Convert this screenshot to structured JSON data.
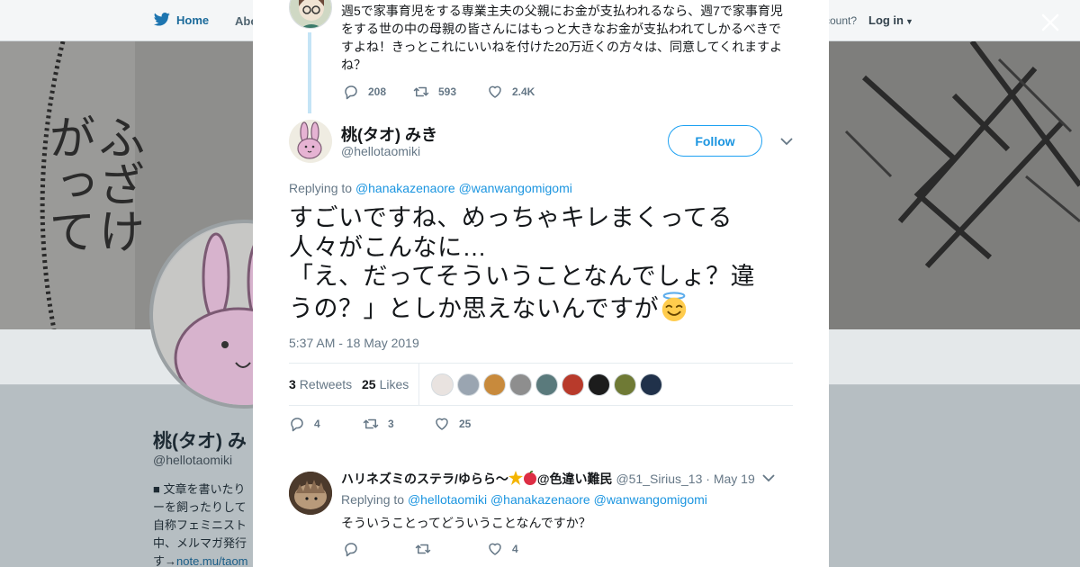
{
  "background": {
    "nav": {
      "home_label": "Home",
      "about_label": "Abo",
      "account_prompt": "ccount?",
      "login_label": "Log in"
    },
    "banner_text": [
      "ふざけ",
      "がって"
    ],
    "profile": {
      "name": "桃(タオ) み",
      "handle": "@hellotaomiki",
      "bio_lines": [
        "■ 文章を書いたり",
        "ーを飼ったりして",
        "自称フェミニスト",
        "中、メルマガ発行"
      ],
      "bio_link_prefix": "す→",
      "bio_link": "note.mu/taom"
    }
  },
  "parent_tweet": {
    "text": "週5で家事育児をする専業主夫の父親にお金が支払われるなら、週7で家事育児をする世の中の母親の皆さんにはもっと大きなお金が支払われてしかるべきですよね！きっとこれにいいねを付けた20万近くの方々は、同意してくれますよね？",
    "replies": "208",
    "retweets": "593",
    "likes": "2.4K"
  },
  "tweet": {
    "author_name": "桃(タオ) みき",
    "author_handle": "@hellotaomiki",
    "follow_label": "Follow",
    "replying_prefix": "Replying to",
    "replying_to": [
      "@hanakazenaore",
      "@wanwangomigomi"
    ],
    "text_line1": "すごいですね、めっちゃキレまくってる",
    "text_line2": "人々がこんなに…",
    "text_line3": "「え、だってそういうことなんでしょ？違",
    "text_line4": "うの？」としか思えないんですが",
    "timestamp": "5:37 AM - 18 May 2019",
    "retweet_count": "3",
    "retweet_label": "Retweets",
    "like_count": "25",
    "like_label": "Likes",
    "action_replies": "4",
    "action_retweets": "3",
    "action_likes": "25",
    "liker_colors": [
      "#e9e3e0",
      "#9aa5b1",
      "#c88a3c",
      "#8e8e8e",
      "#5a7a7c",
      "#b83a2b",
      "#1c1c1c",
      "#6f7a35",
      "#20314a"
    ]
  },
  "reply_tweet": {
    "name_part1": "ハリネズミのステラ/ゆらら〜",
    "name_part2": "@色違い難民",
    "handle": "@51_Sirius_13",
    "separator": "·",
    "date": "May 19",
    "replying_prefix": "Replying to",
    "replying_to": [
      "@hellotaomiki",
      "@hanakazenaore",
      "@wanwangomigomi"
    ],
    "text": "そういうことってどういうことなんですか？",
    "likes": "4"
  },
  "colors": {
    "accent": "#1da1f2",
    "link": "#1b95e0",
    "thread_line": "#c4e4f6",
    "muted": "#657786"
  }
}
